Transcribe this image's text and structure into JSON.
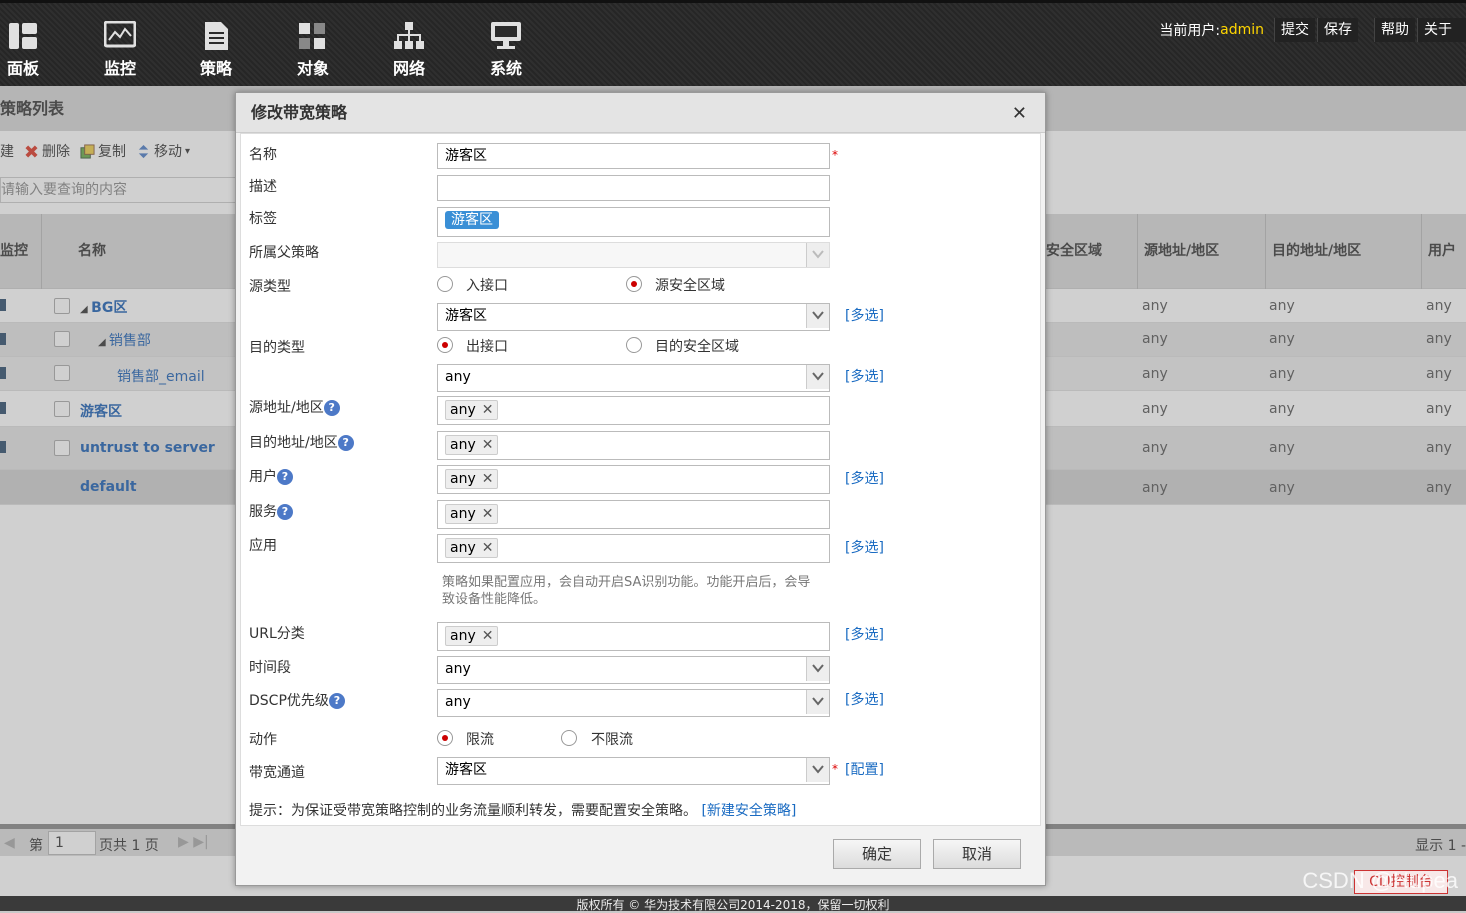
{
  "topnav": {
    "items": [
      {
        "label": "面板",
        "icon": "dashboard-icon"
      },
      {
        "label": "监控",
        "icon": "monitor-icon"
      },
      {
        "label": "策略",
        "icon": "policy-icon"
      },
      {
        "label": "对象",
        "icon": "object-icon"
      },
      {
        "label": "网络",
        "icon": "network-icon"
      },
      {
        "label": "系统",
        "icon": "system-icon"
      }
    ],
    "current_user_label": "当前用户:",
    "current_user": "admin",
    "commit": "提交",
    "save": "保存",
    "help": "帮助",
    "about": "关于"
  },
  "list": {
    "title": "策略列表",
    "toolbar": {
      "new": "建",
      "delete": "删除",
      "copy": "复制",
      "move": "移动"
    },
    "search_placeholder": "请输入要查询的内容",
    "columns": {
      "monitor": "监控",
      "name": "名称",
      "src_zone": "安全区域",
      "src_addr": "源地址/地区",
      "dst_addr": "目的地址/地区",
      "user": "用户"
    },
    "rows": [
      {
        "name": "BG区",
        "src": "any",
        "dst": "any",
        "user": "any"
      },
      {
        "name": "销售部",
        "src": "any",
        "dst": "any",
        "user": "any"
      },
      {
        "name": "销售部_email",
        "src": "any",
        "dst": "any",
        "user": "any"
      },
      {
        "name": "游客区",
        "src": "any",
        "dst": "any",
        "user": "any"
      },
      {
        "name": "untrust to server",
        "src": "any",
        "dst": "any",
        "user": "any"
      },
      {
        "name": "default",
        "src": "any",
        "dst": "any",
        "user": "any"
      }
    ],
    "pager": {
      "page_prefix": "第",
      "page": "1",
      "total": "页共 1 页",
      "display": "显示 1 -"
    }
  },
  "footer": "版权所有 © 华为技术有限公司2014-2018，保留一切权利",
  "dialog": {
    "title": "修改带宽策略",
    "fields": {
      "name_label": "名称",
      "name_value": "游客区",
      "desc_label": "描述",
      "tag_label": "标签",
      "tag_value": "游客区",
      "parent_label": "所属父策略",
      "src_type_label": "源类型",
      "src_opt1": "入接口",
      "src_opt2": "源安全区域",
      "src_zone_value": "游客区",
      "dst_type_label": "目的类型",
      "dst_opt1": "出接口",
      "dst_opt2": "目的安全区域",
      "dst_value": "any",
      "src_addr_label": "源地址/地区",
      "src_addr_tag": "any",
      "dst_addr_label": "目的地址/地区",
      "dst_addr_tag": "any",
      "user_label": "用户",
      "user_tag": "any",
      "service_label": "服务",
      "service_tag": "any",
      "app_label": "应用",
      "app_tag": "any",
      "app_note": "策略如果配置应用，会自动开启SA识别功能。功能开启后，会导致设备性能降低。",
      "url_label": "URL分类",
      "url_tag": "any",
      "time_label": "时间段",
      "time_value": "any",
      "dscp_label": "DSCP优先级",
      "dscp_value": "any",
      "action_label": "动作",
      "action_opt1": "限流",
      "action_opt2": "不限流",
      "channel_label": "带宽通道",
      "channel_value": "游客区"
    },
    "multi_select": "[多选]",
    "configure": "[配置]",
    "hint": "提示：为保证受带宽策略控制的业务流量顺利转发，需要配置安全策略。",
    "hint_link": "[新建安全策略]",
    "ok": "确定",
    "cancel": "取消"
  },
  "console_button": "CLI控制台",
  "watermark": "CSDN @Hupea"
}
